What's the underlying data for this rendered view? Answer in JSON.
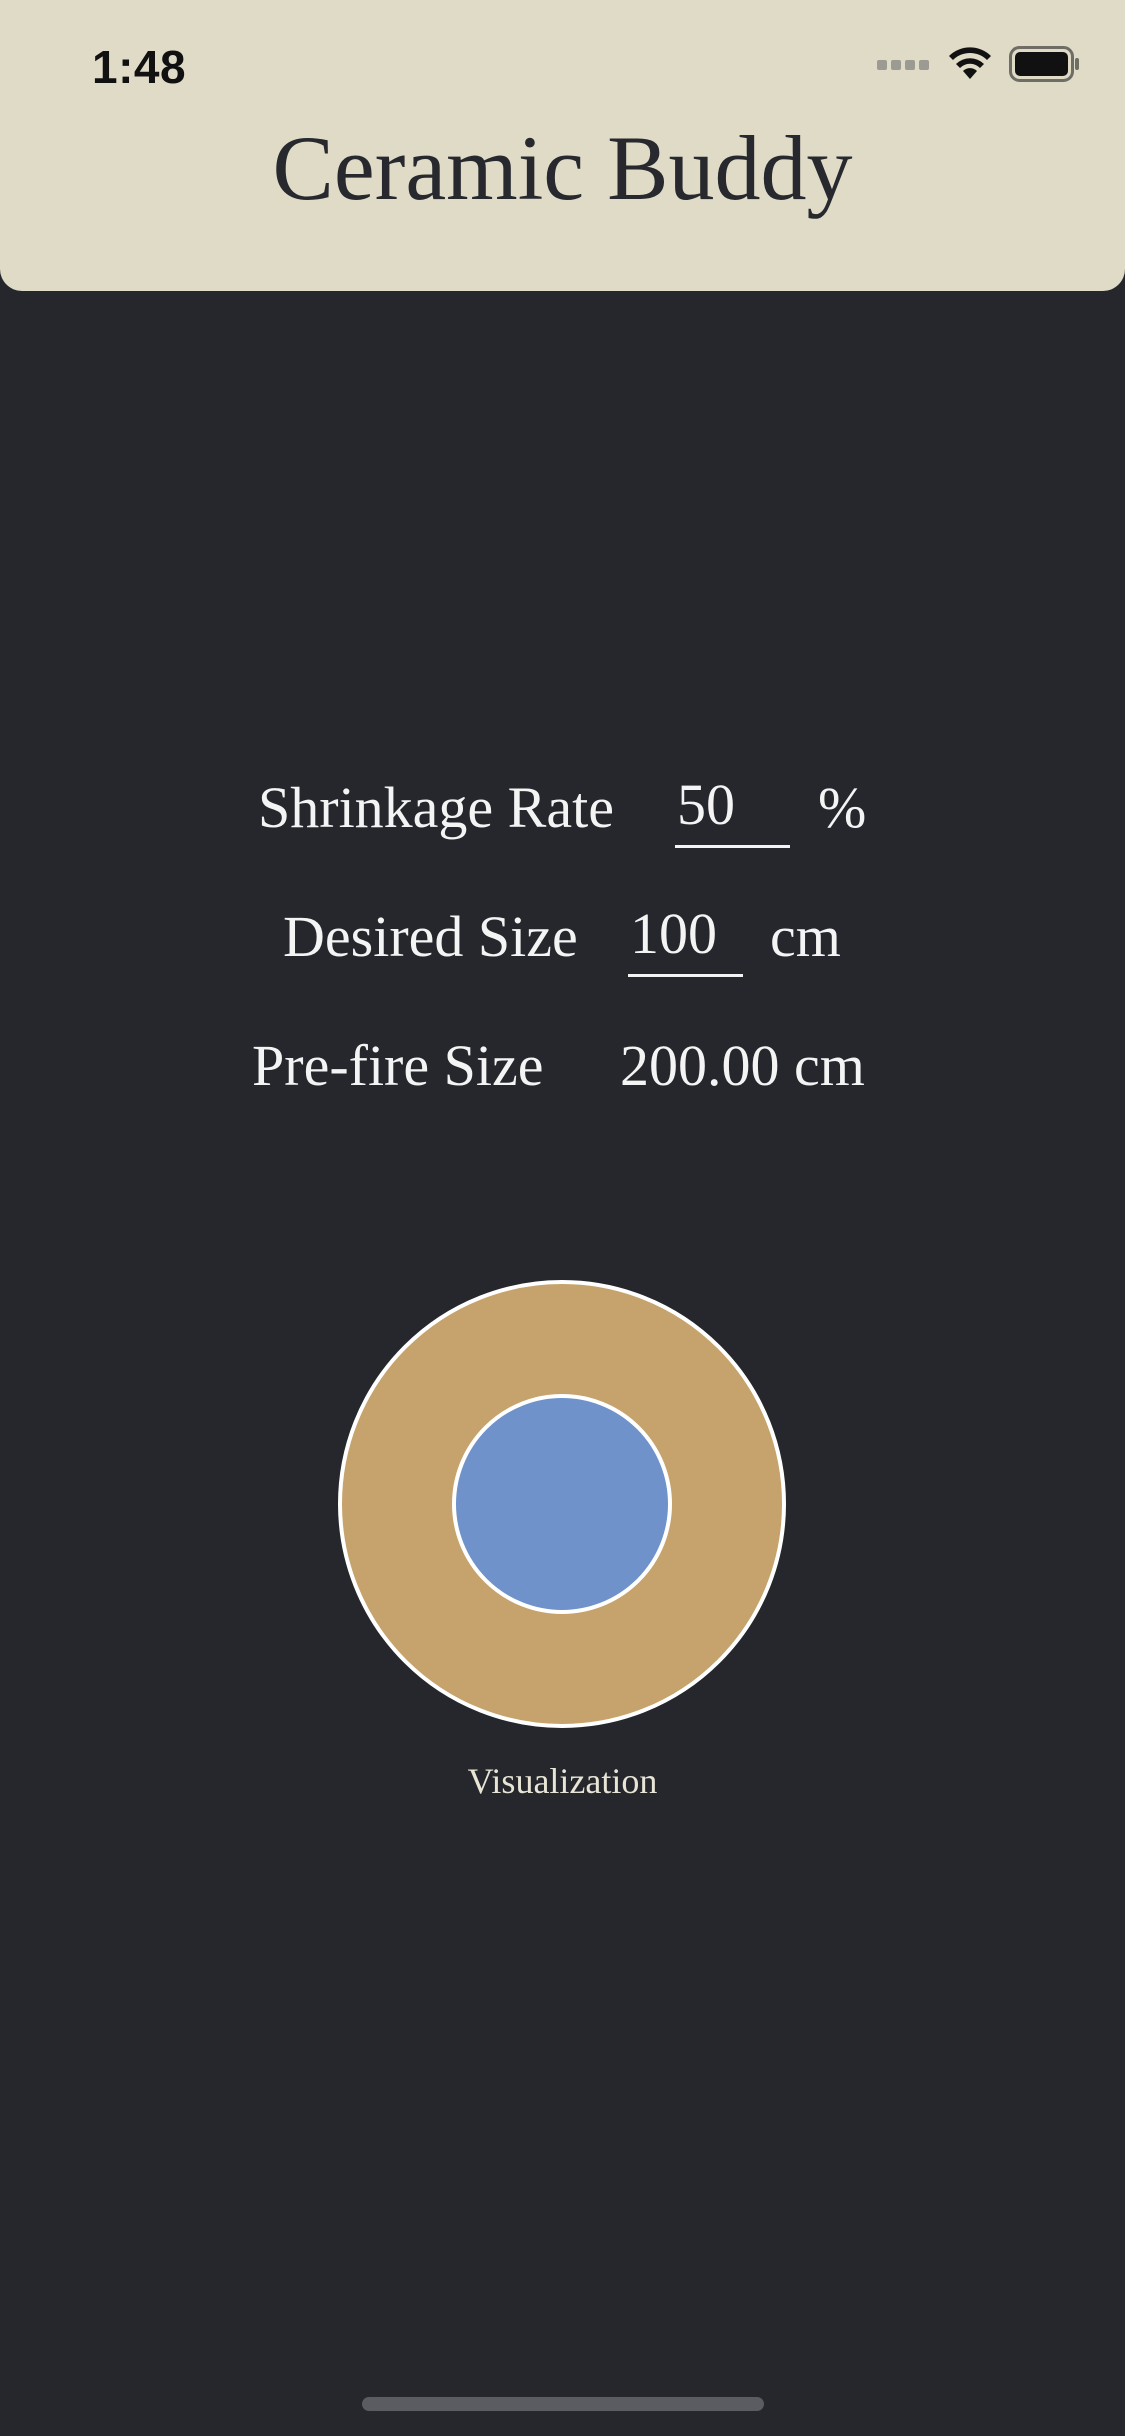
{
  "status_bar": {
    "time": "1:48"
  },
  "app": {
    "title": "Ceramic Buddy"
  },
  "form": {
    "shrinkage_label": "Shrinkage Rate",
    "shrinkage_value": "50",
    "shrinkage_unit": "%",
    "desired_label": "Desired Size",
    "desired_value": "100",
    "desired_unit": "cm",
    "prefire_label": "Pre-fire Size",
    "prefire_value": "200.00 cm"
  },
  "visualization": {
    "caption": "Visualization",
    "outer_color": "#c6a26c",
    "inner_color": "#6e92c9",
    "outline_color": "#ffffff",
    "inner_to_outer_ratio": 0.5
  },
  "colors": {
    "background": "#25272c",
    "header_background": "#dfdbc7",
    "header_text": "#27292e"
  }
}
